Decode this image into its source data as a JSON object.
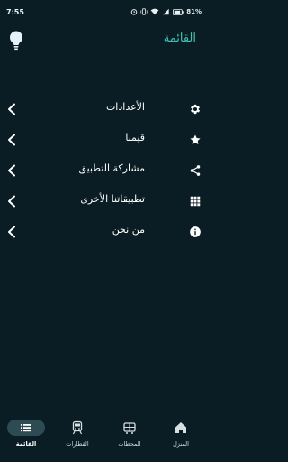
{
  "status_bar": {
    "time": "7:55",
    "battery": "81%"
  },
  "app_bar": {
    "title": "القائمة",
    "title_color": "#41c3b0"
  },
  "menu": {
    "items": [
      {
        "label": "الأعدادات",
        "icon": "gear-icon"
      },
      {
        "label": "قيمنا",
        "icon": "star-icon"
      },
      {
        "label": "مشاركة التطبيق",
        "icon": "share-icon"
      },
      {
        "label": "تطبيقاتنا الأخرى",
        "icon": "apps-grid-icon"
      },
      {
        "label": "من نحن",
        "icon": "info-icon"
      }
    ]
  },
  "bottom_nav": {
    "items": [
      {
        "label": "القائمة",
        "icon": "list-icon",
        "active": true
      },
      {
        "label": "القطارات",
        "icon": "train-icon",
        "active": false
      },
      {
        "label": "المحطات",
        "icon": "station-icon",
        "active": false
      },
      {
        "label": "المنزل",
        "icon": "home-icon",
        "active": false
      }
    ]
  },
  "colors": {
    "background": "#0a1d25",
    "accent": "#41c3b0",
    "active_pill": "#2e4a52"
  }
}
